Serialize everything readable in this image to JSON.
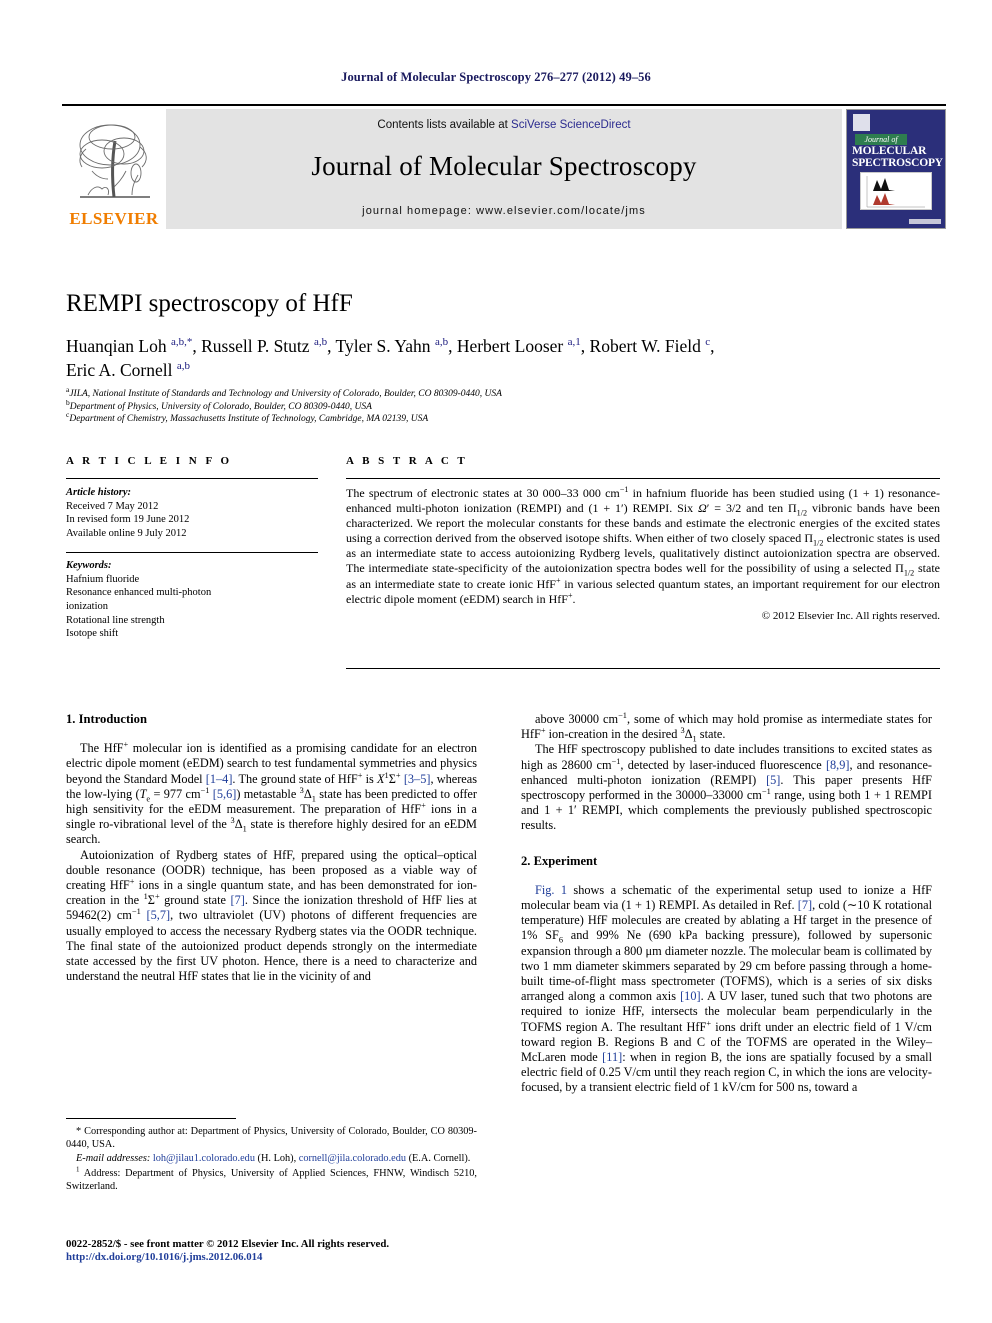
{
  "running_head": "Journal of Molecular Spectroscopy 276–277 (2012) 49–56",
  "masthead": {
    "contents_prefix": "Contents lists available at ",
    "sciencedirect_link": "SciVerse ScienceDirect",
    "journal_title": "Journal of Molecular Spectroscopy",
    "homepage": "journal homepage: www.elsevier.com/locate/jms",
    "publisher_wordmark": "ELSEVIER",
    "cover": {
      "journal_of": "Journal of",
      "name_line1": "MOLECULAR",
      "name_line2": "SPECTROSCOPY"
    }
  },
  "article": {
    "title": "REMPI spectroscopy of HfF",
    "authors_html": "Huanqian Loh <sup>a,b,*</sup>, Russell P. Stutz <sup>a,b</sup>, Tyler S. Yahn <sup>a,b</sup>, Herbert Looser <sup>a,1</sup>, Robert W. Field <sup>c</sup>,<br>Eric A. Cornell <sup>a,b</sup>",
    "affiliations": [
      {
        "mark": "a",
        "text": "JILA, National Institute of Standards and Technology and University of Colorado, Boulder, CO 80309-0440, USA"
      },
      {
        "mark": "b",
        "text": "Department of Physics, University of Colorado, Boulder, CO 80309-0440, USA"
      },
      {
        "mark": "c",
        "text": "Department of Chemistry, Massachusetts Institute of Technology, Cambridge, MA 02139, USA"
      }
    ]
  },
  "article_info": {
    "heading": "A R T I C L E   I N F O",
    "history_label": "Article history:",
    "history": [
      "Received 7 May 2012",
      "In revised form 19 June 2012",
      "Available online 9 July 2012"
    ],
    "keywords_label": "Keywords:",
    "keywords": [
      "Hafnium fluoride",
      "Resonance enhanced multi-photon",
      "ionization",
      "Rotational line strength",
      "Isotope shift"
    ]
  },
  "abstract": {
    "heading": "A B S T R A C T",
    "body_html": "The spectrum of electronic states at 30 000–33 000 cm<sup>−1</sup> in hafnium fluoride has been studied using (1 + 1) resonance-enhanced multi-photon ionization (REMPI) and (1 + 1′) REMPI. Six <span class=\"ital\">Ω</span>′ = 3/2 and ten Π<sub>1/2</sub> vibronic bands have been characterized. We report the molecular constants for these bands and estimate the electronic energies of the excited states using a correction derived from the observed isotope shifts. When either of two closely spaced Π<sub>1/2</sub> electronic states is used as an intermediate state to access autoionizing Rydberg levels, qualitatively distinct autoionization spectra are observed. The intermediate state-specificity of the autoionization spectra bodes well for the possibility of using a selected Π<sub>1/2</sub> state as an intermediate state to create ionic HfF<sup>+</sup> in various selected quantum states, an important requirement for our electron electric dipole moment (eEDM) search in HfF<sup>+</sup>.",
    "copyright": "© 2012 Elsevier Inc. All rights reserved."
  },
  "sections": {
    "introduction_heading": "1. Introduction",
    "experiment_heading": "2. Experiment"
  },
  "left_column": {
    "p1_html": "The HfF<sup>+</sup> molecular ion is identified as a promising candidate for an electron electric dipole moment (eEDM) search to test fundamental symmetries and physics beyond the Standard Model <span class=\"lnk\">[1–4]</span>. The ground state of HfF<sup>+</sup> is <span class=\"ital\">X</span><sup>1</sup>Σ<sup>+</sup> <span class=\"lnk\">[3–5]</span>, whereas the low-lying (<span class=\"ital\">T</span><sub>e</sub> = 977 cm<sup>−1</sup> <span class=\"lnk\">[5,6]</span>) metastable <sup>3</sup>Δ<sub>1</sub> state has been predicted to offer high sensitivity for the eEDM measurement. The preparation of HfF<sup>+</sup> ions in a single ro-vibrational level of the <sup>3</sup>Δ<sub>1</sub> state is therefore highly desired for an eEDM search.",
    "p2_html": "Autoionization of Rydberg states of HfF, prepared using the optical–optical double resonance (OODR) technique, has been proposed as a viable way of creating HfF<sup>+</sup> ions in a single quantum state, and has been demonstrated for ion-creation in the <sup>1</sup>Σ<sup>+</sup> ground state <span class=\"lnk\">[7]</span>. Since the ionization threshold of HfF lies at 59462(2) cm<sup>−1</sup> <span class=\"lnk\">[5,7]</span>, two ultraviolet (UV) photons of different frequencies are usually employed to access the necessary Rydberg states via the OODR technique. The final state of the autoionized product depends strongly on the intermediate state accessed by the first UV photon. Hence, there is a need to characterize and understand the neutral HfF states that lie in the vicinity of and"
  },
  "right_column": {
    "p1_html": "above 30000 cm<sup>−1</sup>, some of which may hold promise as intermediate states for HfF<sup>+</sup> ion-creation in the desired <sup>3</sup>Δ<sub>1</sub> state.",
    "p2_html": "The HfF spectroscopy published to date includes transitions to excited states as high as 28600 cm<sup>−1</sup>, detected by laser-induced fluorescence <span class=\"lnk\">[8,9]</span>, and resonance-enhanced multi-photon ionization (REMPI) <span class=\"lnk\">[5]</span>. This paper presents HfF spectroscopy performed in the 30000–33000 cm<sup>−1</sup> range, using both 1 + 1 REMPI and 1 + 1′ REMPI, which complements the previously published spectroscopic results.",
    "p3_html": "<span class=\"lnk\">Fig. 1</span> shows a schematic of the experimental setup used to ionize a HfF molecular beam via (1 + 1) REMPI. As detailed in Ref. <span class=\"lnk\">[7]</span>, cold (∼10 K rotational temperature) HfF molecules are created by ablating a Hf target in the presence of 1% SF<sub>6</sub> and 99% Ne (690 kPa backing pressure), followed by supersonic expansion through a 800 μm diameter nozzle. The molecular beam is collimated by two 1 mm diameter skimmers separated by 29 cm before passing through a home-built time-of-flight mass spectrometer (TOFMS), which is a series of six disks arranged along a common axis <span class=\"lnk\">[10]</span>. A UV laser, tuned such that two photons are required to ionize HfF, intersects the molecular beam perpendicularly in the TOFMS region A. The resultant HfF<sup>+</sup> ions drift under an electric field of 1 V/cm toward region B. Regions B and C of the TOFMS are operated in the Wiley–McLaren mode <span class=\"lnk\">[11]</span>: when in region B, the ions are spatially focused by a small electric field of 0.25 V/cm until they reach region C, in which the ions are velocity-focused, by a transient electric field of 1 kV/cm for 500 ns, toward a"
  },
  "footnotes": {
    "corresponding_html": "* Corresponding author at: Department of Physics, University of Colorado, Boulder, CO 80309-0440, USA.",
    "email_html": "<i>E-mail addresses:</i> <span class=\"lnk\">loh@jilau1.colorado.edu</span> (H. Loh), <span class=\"lnk\">cornell@jila.colorado.edu</span> (E.A. Cornell).",
    "address_html": "<sup>1</sup> Address: Department of Physics, University of Applied Sciences, FHNW, Windisch 5210, Switzerland."
  },
  "colophon": {
    "issn_line": "0022-2852/$ - see front matter © 2012 Elsevier Inc. All rights reserved.",
    "doi": "http://dx.doi.org/10.1016/j.jms.2012.06.014"
  }
}
